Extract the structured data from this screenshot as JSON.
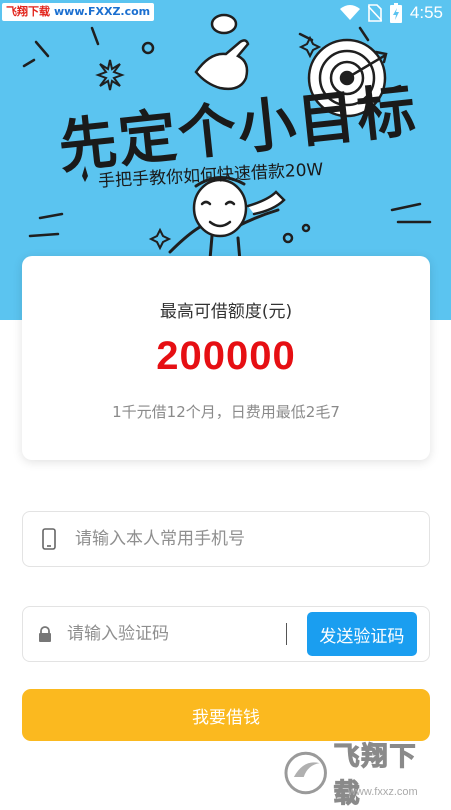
{
  "status_bar": {
    "site_name": "飞翔下载",
    "site_url": "www.FXXZ.com",
    "time": "4:55",
    "icons": [
      "wifi-icon",
      "no-sim-icon",
      "battery-charging-icon"
    ]
  },
  "hero": {
    "headline": "先定个小目标",
    "subtitle": "手把手教你如何快速借款20W"
  },
  "card": {
    "label": "最高可借额度(元)",
    "amount": "200000",
    "note": "1千元借12个月，日费用最低2毛7"
  },
  "form": {
    "phone_placeholder": "请输入本人常用手机号",
    "phone_value": "",
    "code_placeholder": "请输入验证码",
    "code_value": "",
    "send_code_label": "发送验证码",
    "submit_label": "我要借钱"
  },
  "watermark": {
    "brand": "飞翔下载",
    "url": "www.fxxz.com"
  },
  "colors": {
    "hero_bg": "#5bc4f0",
    "amount": "#e60f13",
    "send_button": "#1a9ef0",
    "submit_button": "#fbb91f"
  }
}
